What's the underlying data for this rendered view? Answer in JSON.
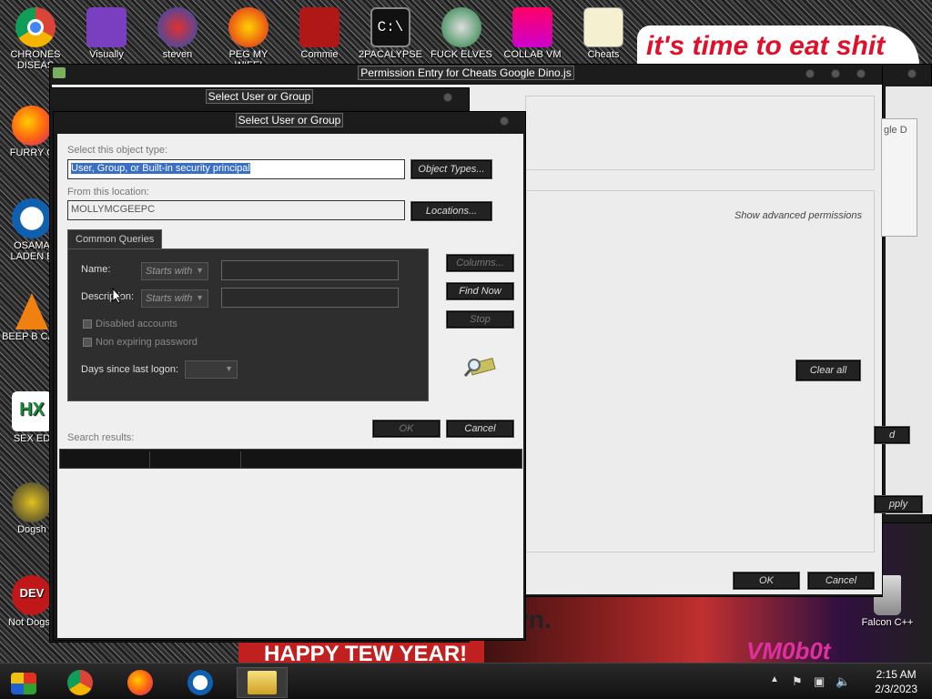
{
  "desktop": {
    "icons": [
      {
        "label": "CHRONES DISEAS"
      },
      {
        "label": "Visually"
      },
      {
        "label": "steven"
      },
      {
        "label": "PEG MY WIFE!"
      },
      {
        "label": "Commie"
      },
      {
        "label": "2PACALYPSE"
      },
      {
        "label": "FUCK ELVES"
      },
      {
        "label": "COLLAB VM"
      },
      {
        "label": "Cheats"
      },
      {
        "label": "FURRY C"
      },
      {
        "label": "OSAMA LADEN B"
      },
      {
        "label": "BEEP B CAR"
      },
      {
        "label": "SEX ED"
      },
      {
        "label": "Dogsh"
      },
      {
        "label": "Not Dogsh"
      },
      {
        "label": "Falcon C++"
      }
    ],
    "banner_text": "it's time to eat shit",
    "photo_text_1": "HAPPY TEW YEAR!",
    "photo_text_2": "rn.",
    "vm_text": "VM0b0t"
  },
  "permission_window": {
    "title": "Permission Entry for Cheats Google Dino.js",
    "partial_text": "gle D",
    "show_advanced": "Show advanced permissions",
    "clear_all": "Clear all",
    "partial_btn1": "d",
    "partial_btn2": "pply",
    "ok": "OK",
    "cancel": "Cancel"
  },
  "back_dialog": {
    "title": "Select User or Group"
  },
  "dialog": {
    "title": "Select User or Group",
    "object_type_label": "Select this object type:",
    "object_type_value": "User, Group, or Built-in security principal",
    "object_types_button": "Object Types...",
    "location_label": "From this location:",
    "location_value": "MOLLYMCGEEPC",
    "locations_button": "Locations...",
    "tab_label": "Common Queries",
    "name_label": "Name:",
    "name_mode": "Starts with",
    "desc_label": "Description:",
    "desc_mode": "Starts with",
    "disabled_accounts": "Disabled accounts",
    "non_expiring": "Non expiring password",
    "days_label": "Days since last logon:",
    "columns_button": "Columns...",
    "find_now_button": "Find Now",
    "stop_button": "Stop",
    "ok_button": "OK",
    "cancel_button": "Cancel",
    "search_results_label": "Search results:"
  },
  "taskbar": {
    "time": "2:15 AM",
    "date": "2/3/2023"
  }
}
